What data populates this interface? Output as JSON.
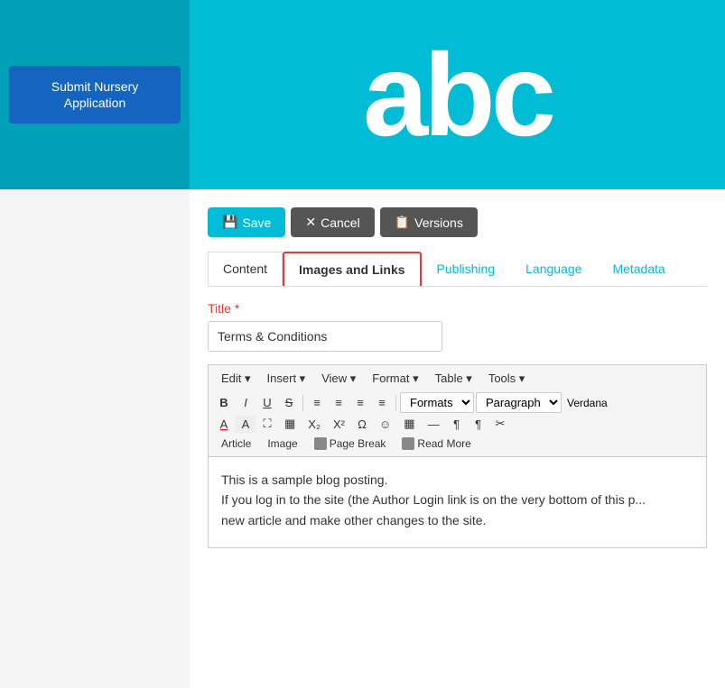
{
  "header": {
    "abc_text": "abc",
    "submit_btn_label": "Submit Nursery Application",
    "background_color": "#00bcd4"
  },
  "toolbar": {
    "save_label": "Save",
    "cancel_label": "Cancel",
    "versions_label": "Versions"
  },
  "tabs": [
    {
      "id": "content",
      "label": "Content",
      "active": false
    },
    {
      "id": "images-and-links",
      "label": "Images and Links",
      "active": true
    },
    {
      "id": "publishing",
      "label": "Publishing",
      "active": false
    },
    {
      "id": "language",
      "label": "Language",
      "active": false
    },
    {
      "id": "metadata",
      "label": "Metadata",
      "active": false
    }
  ],
  "title_field": {
    "label": "Title",
    "required": true,
    "value": "Terms & Conditions"
  },
  "editor": {
    "menu": [
      {
        "label": "Edit"
      },
      {
        "label": "Insert"
      },
      {
        "label": "View"
      },
      {
        "label": "Format"
      },
      {
        "label": "Table"
      },
      {
        "label": "Tools"
      }
    ],
    "format_row": {
      "bold": "B",
      "italic": "I",
      "underline": "U",
      "strikethrough": "S",
      "formats_dropdown": "Formats",
      "paragraph_dropdown": "Paragraph",
      "font_dropdown": "Verdana"
    },
    "actions": [
      {
        "label": "Article"
      },
      {
        "label": "Image"
      },
      {
        "label": "Page Break"
      },
      {
        "label": "Read More"
      }
    ],
    "content_lines": [
      "This is a sample blog posting.",
      "If you log in to the site (the Author Login link is on the very bottom of this p...",
      "new article and make other changes to the site."
    ]
  }
}
